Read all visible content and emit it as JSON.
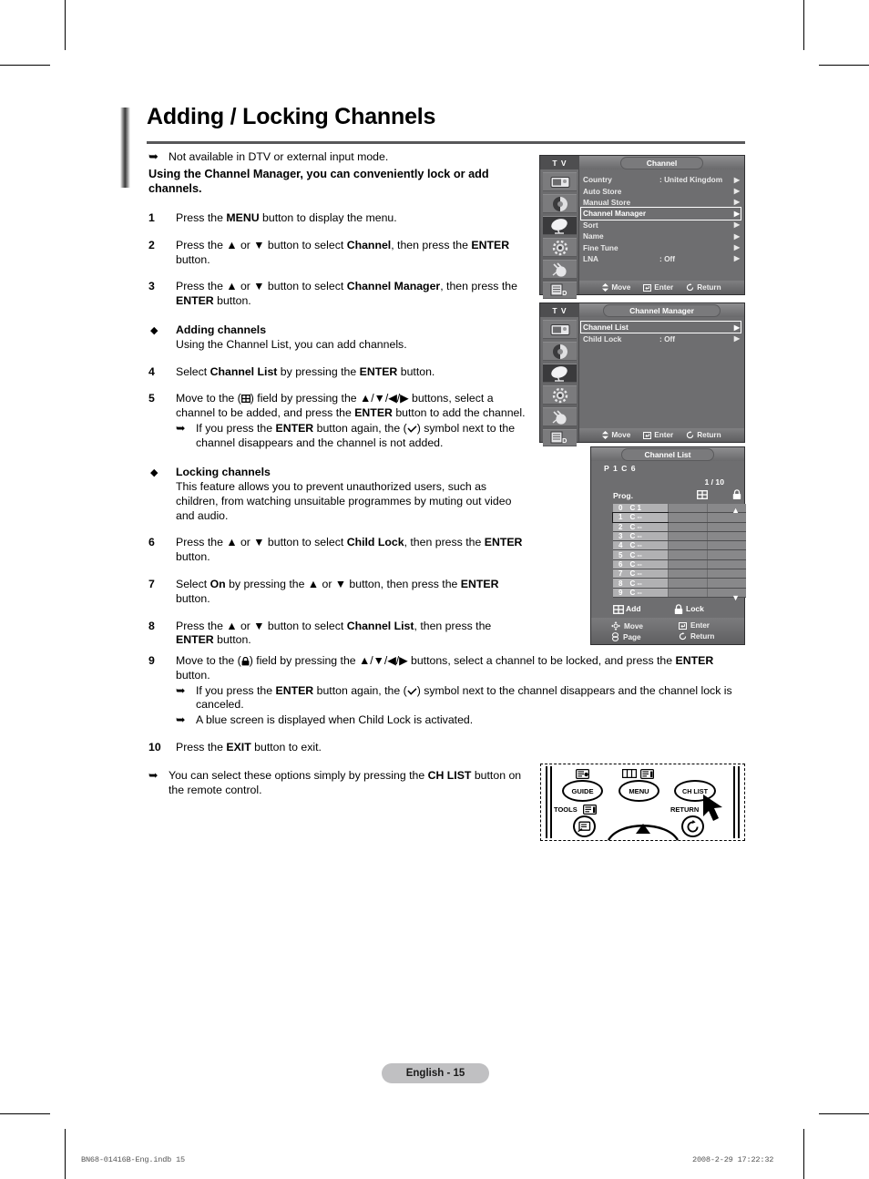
{
  "page": {
    "title": "Adding / Locking Channels",
    "footer_pill": "English - 15",
    "imprint_left": "BN68-01416B-Eng.indb   15",
    "imprint_right": "2008-2-29    17:22:32"
  },
  "intro": {
    "note": "Not available in DTV or external input mode.",
    "lead_line1": "Using the Channel Manager, you can conveniently lock or add",
    "lead_line2": "channels."
  },
  "steps": [
    {
      "num": "1",
      "text": "Press the MENU button to display the menu."
    },
    {
      "num": "2",
      "text": "Press the ▲ or ▼ button to select Channel, then press the ENTER button."
    },
    {
      "num": "3",
      "text": "Press the ▲ or ▼ button to select Channel Manager, then press the ENTER button."
    },
    {
      "num": "4",
      "text": "Select Channel List by pressing the ENTER button."
    },
    {
      "num": "5",
      "text": "Move to the (⊞) field by pressing the ▲/▼/◀/▶ buttons, select a channel to be added, and press the ENTER button to add the channel."
    },
    {
      "num": "6",
      "text": "Press the ▲ or ▼ button to select Child Lock, then press the ENTER button."
    },
    {
      "num": "7",
      "text": "Select On by pressing the ▲ or ▼ button, then press the ENTER button."
    },
    {
      "num": "8",
      "text": "Press the ▲ or ▼ button to select Channel List, then press the ENTER button."
    },
    {
      "num": "9",
      "text": "Move to the (🔒) field by pressing the ▲/▼/◀/▶ buttons, select a channel to be locked, and press the ENTER button."
    },
    {
      "num": "10",
      "text": "Press the EXIT button to exit."
    }
  ],
  "sections": {
    "adding": {
      "heading": "Adding channels",
      "body": "Using the Channel List, you can add channels."
    },
    "locking": {
      "heading": "Locking channels",
      "body": "This feature allows you to prevent unauthorized users, such as children, from watching unsuitable programmes by muting out video and audio."
    }
  },
  "notes": {
    "step5_note": "If you press the ENTER button again, the (✓) symbol next to the channel disappears and the channel is not added.",
    "step9_note1": "If you press the ENTER button again, the (✓) symbol next to the channel disappears and the channel lock is canceled.",
    "step9_note2": "A blue screen is displayed when Child Lock is activated.",
    "tip": "You can select these options simply by pressing the CH LIST button on the remote control."
  },
  "osd_channel": {
    "device_label": "T V",
    "title": "Channel",
    "rows": [
      {
        "label": "Country",
        "value": ": United Kingdom",
        "caret": "▶",
        "selected": false
      },
      {
        "label": "Auto Store",
        "value": "",
        "caret": "▶",
        "selected": false
      },
      {
        "label": "Manual Store",
        "value": "",
        "caret": "▶",
        "selected": false
      },
      {
        "label": "Channel Manager",
        "value": "",
        "caret": "▶",
        "selected": true
      },
      {
        "label": "Sort",
        "value": "",
        "caret": "▶",
        "selected": false
      },
      {
        "label": "Name",
        "value": "",
        "caret": "▶",
        "selected": false
      },
      {
        "label": "Fine Tune",
        "value": "",
        "caret": "▶",
        "selected": false
      },
      {
        "label": "LNA",
        "value": ": Off",
        "caret": "▶",
        "selected": false
      }
    ],
    "footer": {
      "move": "Move",
      "enter": "Enter",
      "return": "Return"
    }
  },
  "osd_manager": {
    "device_label": "T V",
    "title": "Channel Manager",
    "rows": [
      {
        "label": "Channel List",
        "value": "",
        "caret": "▶",
        "selected": true
      },
      {
        "label": "Child Lock",
        "value": ": Off",
        "caret": "▶",
        "selected": false
      }
    ],
    "footer": {
      "move": "Move",
      "enter": "Enter",
      "return": "Return"
    }
  },
  "osd_channel_list": {
    "title": "Channel List",
    "current": "P 1  C 6",
    "page": "1 / 10",
    "col_prog": "Prog.",
    "rows": [
      {
        "num": "0",
        "name": "C 1",
        "current": false
      },
      {
        "num": "1",
        "name": "C --",
        "current": true
      },
      {
        "num": "2",
        "name": "C --",
        "current": false
      },
      {
        "num": "3",
        "name": "C --",
        "current": false
      },
      {
        "num": "4",
        "name": "C --",
        "current": false
      },
      {
        "num": "5",
        "name": "C --",
        "current": false
      },
      {
        "num": "6",
        "name": "C --",
        "current": false
      },
      {
        "num": "7",
        "name": "C --",
        "current": false
      },
      {
        "num": "8",
        "name": "C --",
        "current": false
      },
      {
        "num": "9",
        "name": "C --",
        "current": false
      }
    ],
    "legend": {
      "add": "Add",
      "lock": "Lock"
    },
    "footer": {
      "move": "Move",
      "page": "Page",
      "enter": "Enter",
      "return": "Return"
    }
  },
  "remote": {
    "guide": "GUIDE",
    "menu": "MENU",
    "ch_list": "CH LIST",
    "tools": "TOOLS",
    "return": "RETURN"
  }
}
